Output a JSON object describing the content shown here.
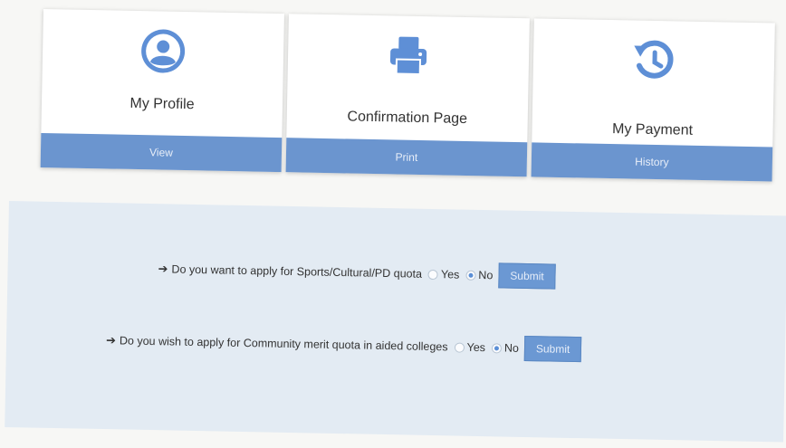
{
  "cards": [
    {
      "label": "My Profile",
      "action": "View",
      "icon": "user-profile-icon"
    },
    {
      "label": "Confirmation Page",
      "action": "Print",
      "icon": "printer-icon"
    },
    {
      "label": "My Payment",
      "action": "History",
      "icon": "history-icon"
    }
  ],
  "questions": [
    {
      "text": "Do you want to apply for Sports/Cultural/PD quota",
      "yes": "Yes",
      "no": "No",
      "selected": "No",
      "submit": "Submit"
    },
    {
      "text": "Do you wish to apply for Community merit quota in aided colleges",
      "yes": "Yes",
      "no": "No",
      "selected": "No",
      "submit": "Submit"
    }
  ],
  "colors": {
    "accent": "#6b95cf",
    "panel": "#e3ebf3"
  }
}
